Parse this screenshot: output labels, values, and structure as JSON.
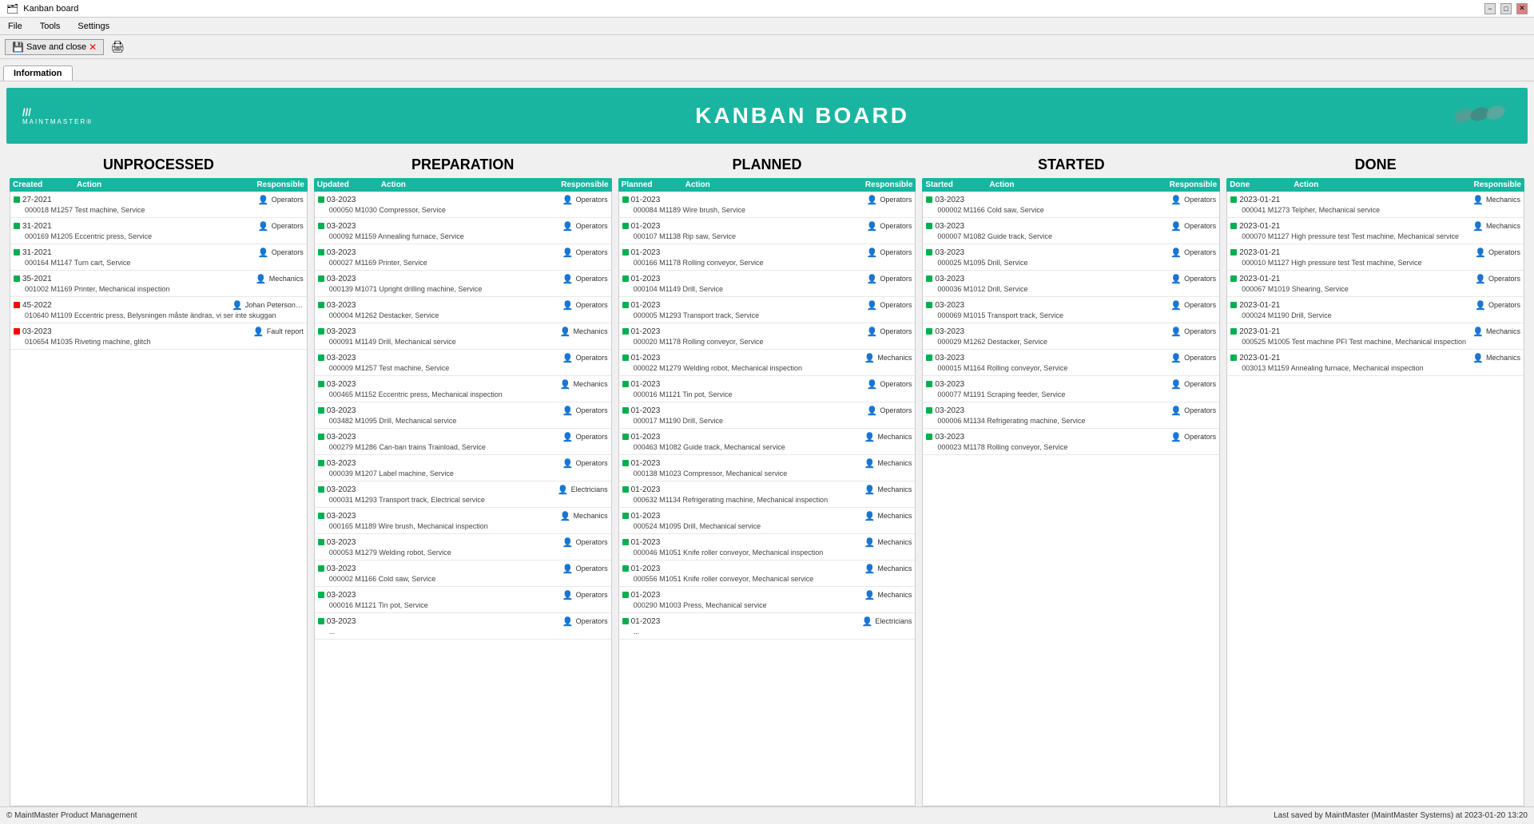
{
  "window": {
    "title": "Kanban board",
    "min": "−",
    "restore": "□",
    "close": "✕"
  },
  "menubar": {
    "items": [
      "File",
      "Tools",
      "Settings"
    ]
  },
  "toolbar": {
    "save_close": "Save and close"
  },
  "tab": {
    "label": "Information"
  },
  "banner": {
    "title": "KANBAN BOARD",
    "logo_line1": "///",
    "logo_line2": "MAINTMASTER®"
  },
  "columns": [
    {
      "id": "unprocessed",
      "title": "UNPROCESSED",
      "headers": [
        "Created",
        "Action",
        "Responsible"
      ],
      "items": [
        {
          "date": "27-2021",
          "dot": "green",
          "action": "",
          "resp": "Operators",
          "detail": "000018 M1257  Test machine, Service"
        },
        {
          "date": "31-2021",
          "dot": "green",
          "action": "",
          "resp": "Operators",
          "detail": "000169 M1205  Eccentric press, Service"
        },
        {
          "date": "31-2021",
          "dot": "green",
          "action": "",
          "resp": "Operators",
          "detail": "000164 M1147  Turn cart, Service"
        },
        {
          "date": "35-2021",
          "dot": "green",
          "action": "",
          "resp": "Mechanics",
          "detail": "001002 M1169  Printer, Mechanical inspection"
        },
        {
          "date": "45-2022",
          "dot": "red",
          "action": "",
          "resp": "Johan Peterson (A...",
          "detail": "010640 M1109  Eccentric press, Belysningen måste ändras, vi ser inte skuggan"
        },
        {
          "date": "03-2023",
          "dot": "red",
          "action": "",
          "resp": "Fault report",
          "detail": "010654 M1035  Riveting machine, glitch"
        }
      ]
    },
    {
      "id": "preparation",
      "title": "PREPARATION",
      "headers": [
        "Updated",
        "Action",
        "Responsible"
      ],
      "items": [
        {
          "date": "03-2023",
          "dot": "green",
          "action": "",
          "resp": "Operators",
          "detail": "000050 M1030  Compressor, Service"
        },
        {
          "date": "03-2023",
          "dot": "green",
          "action": "",
          "resp": "Operators",
          "detail": "000092 M1159  Annealing furnace, Service"
        },
        {
          "date": "03-2023",
          "dot": "green",
          "action": "",
          "resp": "Operators",
          "detail": "000027 M1169  Printer, Service"
        },
        {
          "date": "03-2023",
          "dot": "green",
          "action": "",
          "resp": "Operators",
          "detail": "000139 M1071  Upright drilling machine, Service"
        },
        {
          "date": "03-2023",
          "dot": "green",
          "action": "",
          "resp": "Operators",
          "detail": "000004 M1262  Destacker, Service"
        },
        {
          "date": "03-2023",
          "dot": "green",
          "action": "",
          "resp": "Mechanics",
          "detail": "000091 M1149  Drill, Mechanical service"
        },
        {
          "date": "03-2023",
          "dot": "green",
          "action": "",
          "resp": "Operators",
          "detail": "000009 M1257  Test machine, Service"
        },
        {
          "date": "03-2023",
          "dot": "green",
          "action": "",
          "resp": "Mechanics",
          "detail": "000465 M1152  Eccentric press, Mechanical inspection"
        },
        {
          "date": "03-2023",
          "dot": "green",
          "action": "",
          "resp": "Operators",
          "detail": "003482 M1095  Drill, Mechanical service"
        },
        {
          "date": "03-2023",
          "dot": "green",
          "action": "",
          "resp": "Operators",
          "detail": "000279 M1286  Can-ban trains Trainload, Service"
        },
        {
          "date": "03-2023",
          "dot": "green",
          "action": "",
          "resp": "Operators",
          "detail": "000039 M1207  Label machine, Service"
        },
        {
          "date": "03-2023",
          "dot": "green",
          "action": "",
          "resp": "Electricians",
          "detail": "000031 M1293  Transport track, Electrical service"
        },
        {
          "date": "03-2023",
          "dot": "green",
          "action": "",
          "resp": "Mechanics",
          "detail": "000165 M1189  Wire brush, Mechanical inspection"
        },
        {
          "date": "03-2023",
          "dot": "green",
          "action": "",
          "resp": "Operators",
          "detail": "000053 M1279  Welding robot, Service"
        },
        {
          "date": "03-2023",
          "dot": "green",
          "action": "",
          "resp": "Operators",
          "detail": "000002 M1166  Cold saw, Service"
        },
        {
          "date": "03-2023",
          "dot": "green",
          "action": "",
          "resp": "Operators",
          "detail": "000016 M1121  Tin pot, Service"
        },
        {
          "date": "03-2023",
          "dot": "green",
          "action": "",
          "resp": "Operators",
          "detail": "..."
        }
      ]
    },
    {
      "id": "planned",
      "title": "PLANNED",
      "headers": [
        "Planned",
        "Action",
        "Responsible"
      ],
      "items": [
        {
          "date": "01-2023",
          "dot": "green",
          "action": "",
          "resp": "Operators",
          "detail": "000084 M1189  Wire brush, Service"
        },
        {
          "date": "01-2023",
          "dot": "green",
          "action": "",
          "resp": "Operators",
          "detail": "000107 M1138  Rip saw, Service"
        },
        {
          "date": "01-2023",
          "dot": "green",
          "action": "",
          "resp": "Operators",
          "detail": "000166 M1178  Rolling conveyor, Service"
        },
        {
          "date": "01-2023",
          "dot": "green",
          "action": "",
          "resp": "Operators",
          "detail": "000104 M1149  Drill, Service"
        },
        {
          "date": "01-2023",
          "dot": "green",
          "action": "",
          "resp": "Operators",
          "detail": "000005 M1293  Transport track, Service"
        },
        {
          "date": "01-2023",
          "dot": "green",
          "action": "",
          "resp": "Operators",
          "detail": "000020 M1178  Rolling conveyor, Service"
        },
        {
          "date": "01-2023",
          "dot": "green",
          "action": "",
          "resp": "Mechanics",
          "detail": "000022 M1279  Welding robot, Mechanical inspection"
        },
        {
          "date": "01-2023",
          "dot": "green",
          "action": "",
          "resp": "Operators",
          "detail": "000016 M1121  Tin pot, Service"
        },
        {
          "date": "01-2023",
          "dot": "green",
          "action": "",
          "resp": "Operators",
          "detail": "000017 M1190  Drill, Service"
        },
        {
          "date": "01-2023",
          "dot": "green",
          "action": "",
          "resp": "Mechanics",
          "detail": "000463 M1082  Guide track, Mechanical service"
        },
        {
          "date": "01-2023",
          "dot": "green",
          "action": "",
          "resp": "Mechanics",
          "detail": "000138 M1023  Compressor, Mechanical service"
        },
        {
          "date": "01-2023",
          "dot": "green",
          "action": "",
          "resp": "Mechanics",
          "detail": "000632 M1134  Refrigerating machine, Mechanical inspection"
        },
        {
          "date": "01-2023",
          "dot": "green",
          "action": "",
          "resp": "Mechanics",
          "detail": "000524 M1095  Drill, Mechanical service"
        },
        {
          "date": "01-2023",
          "dot": "green",
          "action": "",
          "resp": "Mechanics",
          "detail": "000046 M1051  Knife roller conveyor, Mechanical inspection"
        },
        {
          "date": "01-2023",
          "dot": "green",
          "action": "",
          "resp": "Mechanics",
          "detail": "000556 M1051  Knife roller conveyor, Mechanical service"
        },
        {
          "date": "01-2023",
          "dot": "green",
          "action": "",
          "resp": "Mechanics",
          "detail": "000290 M1003  Press, Mechanical service"
        },
        {
          "date": "01-2023",
          "dot": "green",
          "action": "",
          "resp": "Electricians",
          "detail": "..."
        }
      ]
    },
    {
      "id": "started",
      "title": "STARTED",
      "headers": [
        "Started",
        "Action",
        "Responsible"
      ],
      "items": [
        {
          "date": "03-2023",
          "dot": "green",
          "action": "",
          "resp": "Operators",
          "detail": "000002 M1166  Cold saw, Service"
        },
        {
          "date": "03-2023",
          "dot": "green",
          "action": "",
          "resp": "Operators",
          "detail": "000007 M1082  Guide track, Service"
        },
        {
          "date": "03-2023",
          "dot": "green",
          "action": "",
          "resp": "Operators",
          "detail": "000025 M1095  Drill, Service"
        },
        {
          "date": "03-2023",
          "dot": "green",
          "action": "",
          "resp": "Operators",
          "detail": "000036 M1012  Drill, Service"
        },
        {
          "date": "03-2023",
          "dot": "green",
          "action": "",
          "resp": "Operators",
          "detail": "000069 M1015  Transport track, Service"
        },
        {
          "date": "03-2023",
          "dot": "green",
          "action": "",
          "resp": "Operators",
          "detail": "000029 M1262  Destacker, Service"
        },
        {
          "date": "03-2023",
          "dot": "green",
          "action": "",
          "resp": "Operators",
          "detail": "000015 M1164  Rolling conveyor, Service"
        },
        {
          "date": "03-2023",
          "dot": "green",
          "action": "",
          "resp": "Operators",
          "detail": "000077 M1191  Scraping feeder, Service"
        },
        {
          "date": "03-2023",
          "dot": "green",
          "action": "",
          "resp": "Operators",
          "detail": "000006 M1134  Refrigerating machine, Service"
        },
        {
          "date": "03-2023",
          "dot": "green",
          "action": "",
          "resp": "Operators",
          "detail": "000023 M1178  Rolling conveyor, Service"
        }
      ]
    },
    {
      "id": "done",
      "title": "DONE",
      "headers": [
        "Done",
        "Action",
        "Responsible"
      ],
      "items": [
        {
          "date": "2023-01-21",
          "dot": "green",
          "action": "",
          "resp": "Mechanics",
          "detail": "000041 M1273  Telpher, Mechanical service"
        },
        {
          "date": "2023-01-21",
          "dot": "green",
          "action": "",
          "resp": "Mechanics",
          "detail": "000070 M1127  High pressure test Test machine, Mechanical service"
        },
        {
          "date": "2023-01-21",
          "dot": "green",
          "action": "",
          "resp": "Operators",
          "detail": "000010 M1127  High pressure test Test machine, Service"
        },
        {
          "date": "2023-01-21",
          "dot": "green",
          "action": "",
          "resp": "Operators",
          "detail": "000067 M1019  Shearing, Service"
        },
        {
          "date": "2023-01-21",
          "dot": "green",
          "action": "",
          "resp": "Operators",
          "detail": "000024 M1190  Drill, Service"
        },
        {
          "date": "2023-01-21",
          "dot": "green",
          "action": "",
          "resp": "Mechanics",
          "detail": "000525 M1005  Test machine PFI Test machine, Mechanical inspection"
        },
        {
          "date": "2023-01-21",
          "dot": "green",
          "action": "",
          "resp": "Mechanics",
          "detail": "003013 M1159  Annealing furnace, Mechanical inspection"
        }
      ]
    }
  ],
  "statusbar": {
    "left": "© MaintMaster Product Management",
    "right": "Last saved by MaintMaster (MaintMaster Systems) at 2023-01-20 13:20"
  }
}
